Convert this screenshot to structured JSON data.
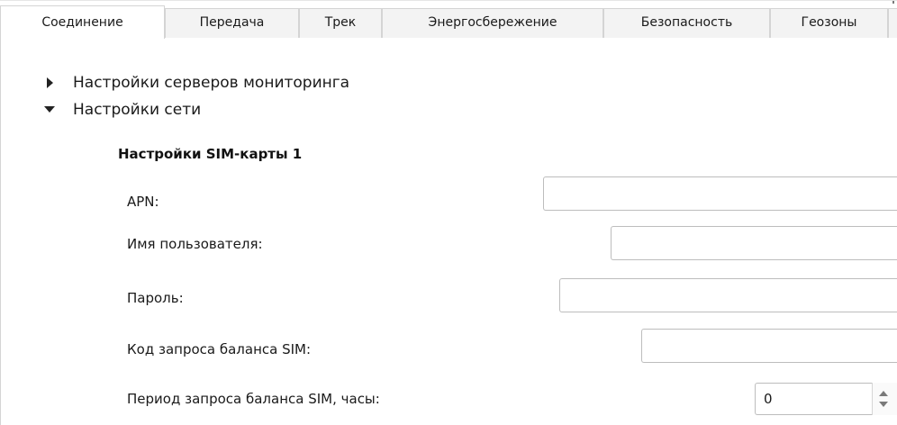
{
  "tabs": [
    {
      "label": "Соединение",
      "active": true
    },
    {
      "label": "Передача",
      "active": false
    },
    {
      "label": "Трек",
      "active": false
    },
    {
      "label": "Энергосбережение",
      "active": false
    },
    {
      "label": "Безопасность",
      "active": false
    },
    {
      "label": "Геозоны",
      "active": false
    }
  ],
  "tree": {
    "monitoring_servers": {
      "label": "Настройки серверов мониторинга",
      "expanded": false
    },
    "network": {
      "label": "Настройки сети",
      "expanded": true
    }
  },
  "sim1": {
    "title": "Настройки SIM-карты 1",
    "apn": {
      "label": "APN:",
      "value": ""
    },
    "username": {
      "label": "Имя пользователя:",
      "value": ""
    },
    "password": {
      "label": "Пароль:",
      "value": ""
    },
    "balance_code": {
      "label": "Код запроса баланса SIM:",
      "value": ""
    },
    "balance_period": {
      "label": "Период запроса баланса SIM, часы:",
      "value": "0"
    }
  },
  "colors": {
    "border": "#d4d4d4",
    "inactive_tab": "#f3f3f3",
    "field_border": "#bdbdbd"
  }
}
